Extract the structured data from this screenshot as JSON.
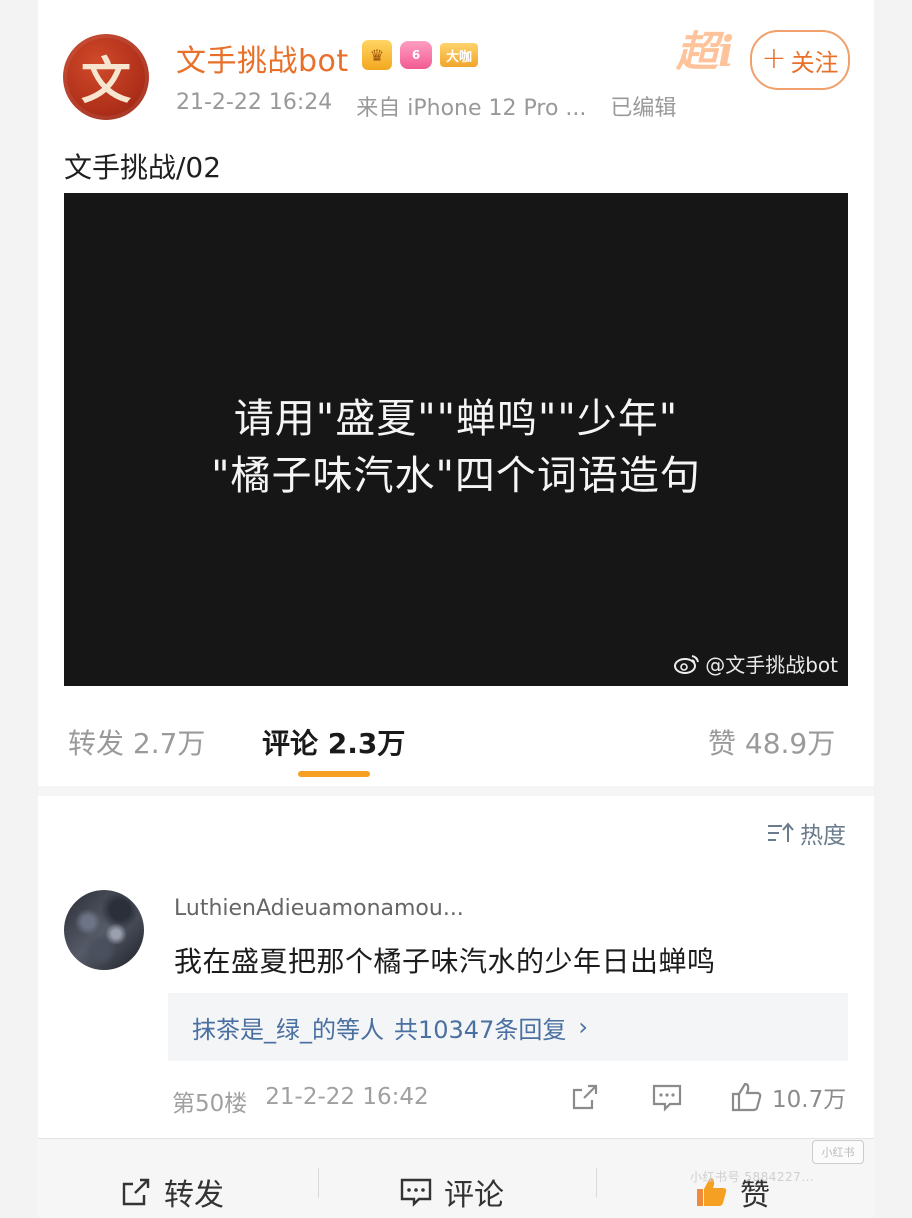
{
  "header": {
    "avatar_char": "文",
    "username": "文手挑战bot",
    "level_badge": "6",
    "vip_badge": "大咖",
    "post_time": "21-2-22 16:24",
    "source": "来自 iPhone 12 Pro ...",
    "edited": "已编辑",
    "super_mark": "超i",
    "follow_plus": "+",
    "follow_label": "关注"
  },
  "post": {
    "title": "文手挑战/02",
    "image_line1": "请用\"盛夏\"\"蝉鸣\"\"少年\"",
    "image_line2": "\"橘子味汽水\"四个词语造句",
    "watermark": "@文手挑战bot"
  },
  "stats": {
    "repost": "转发 2.7万",
    "comment": "评论 2.3万",
    "like": "赞 48.9万"
  },
  "sort_label": "热度",
  "comment": {
    "user": "LuthienAdieuamonamou...",
    "text": "我在盛夏把那个橘子味汽水的少年日出蝉鸣",
    "reply_users": "抹茶是_绿_的等人",
    "reply_count": "共10347条回复",
    "reply_chevron": "›",
    "floor": "第50楼",
    "time": "21-2-22 16:42",
    "likes": "10.7万"
  },
  "bottom_bar": {
    "repost": "转发",
    "comment": "评论",
    "like": "赞"
  },
  "overlay": {
    "xhs_mark": "小红书",
    "xhs_id": "小红书号 5884227..."
  },
  "colors": {
    "accent_orange": "#e8702a",
    "tab_underline": "#f5a023",
    "link_blue": "#4a6fa1",
    "image_bg": "#151615"
  }
}
